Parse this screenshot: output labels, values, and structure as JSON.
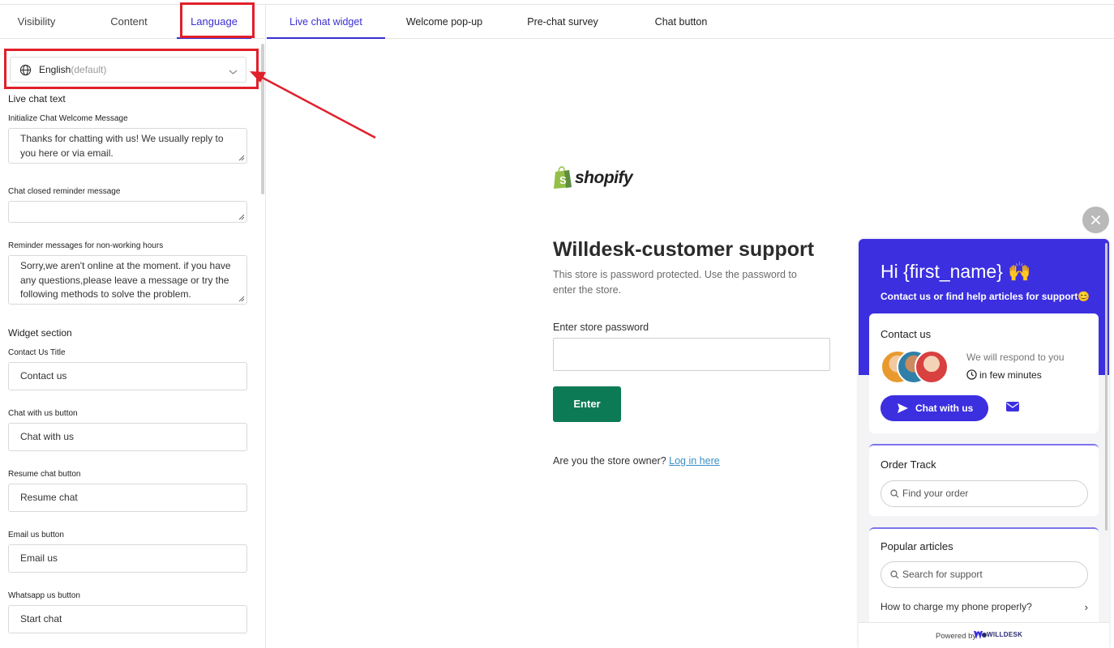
{
  "left_tabs": [
    "Visibility",
    "Content",
    "Language"
  ],
  "language": {
    "name": "English",
    "suffix": "(default)"
  },
  "live_chat": {
    "section": "Live chat text",
    "fields": [
      {
        "label": "Initialize Chat Welcome Message",
        "value": "Thanks for chatting with us! We usually reply to you here or via email."
      },
      {
        "label": "Chat closed reminder message",
        "value": ""
      },
      {
        "label": "Reminder messages for non-working hours",
        "value": "Sorry,we aren't online at the moment. if you have any questions,please leave a message or try the following methods to solve the problem."
      }
    ]
  },
  "widget_section": {
    "section": "Widget section",
    "fields": [
      {
        "label": "Contact Us Title",
        "value": "Contact us"
      },
      {
        "label": "Chat with us button",
        "value": "Chat with us"
      },
      {
        "label": "Resume chat button",
        "value": "Resume chat"
      },
      {
        "label": "Email us button",
        "value": "Email us"
      },
      {
        "label": "Whatsapp us button",
        "value": "Start chat"
      }
    ]
  },
  "right_tabs": [
    "Live chat widget",
    "Welcome pop-up",
    "Pre-chat survey",
    "Chat button"
  ],
  "store": {
    "logo_text": "shopify",
    "title": "Willdesk-customer support",
    "subtitle": "This store is password protected. Use the password to enter the store.",
    "password_label": "Enter store password",
    "enter_button": "Enter",
    "owner_text": "Are you the store owner?",
    "owner_link": "Log in here"
  },
  "widget": {
    "greeting": "Hi {first_name} 🙌",
    "subtitle": "Contact us or find help articles for support😊",
    "contact": {
      "title": "Contact us",
      "respond_line1": "We will respond to you",
      "respond_line2": "in few minutes",
      "chat_button": "Chat with us"
    },
    "order": {
      "title": "Order Track",
      "placeholder": "Find your order"
    },
    "articles": {
      "title": "Popular articles",
      "placeholder": "Search for support",
      "items": [
        "How to charge my phone properly?"
      ]
    },
    "powered_by": "Powered by",
    "brand": "WILLDESK"
  },
  "colors": {
    "accent": "#3b2fe0",
    "enter_green": "#0d7a56",
    "annotation_red": "#e0202a",
    "link_blue": "#3a8fc4"
  }
}
